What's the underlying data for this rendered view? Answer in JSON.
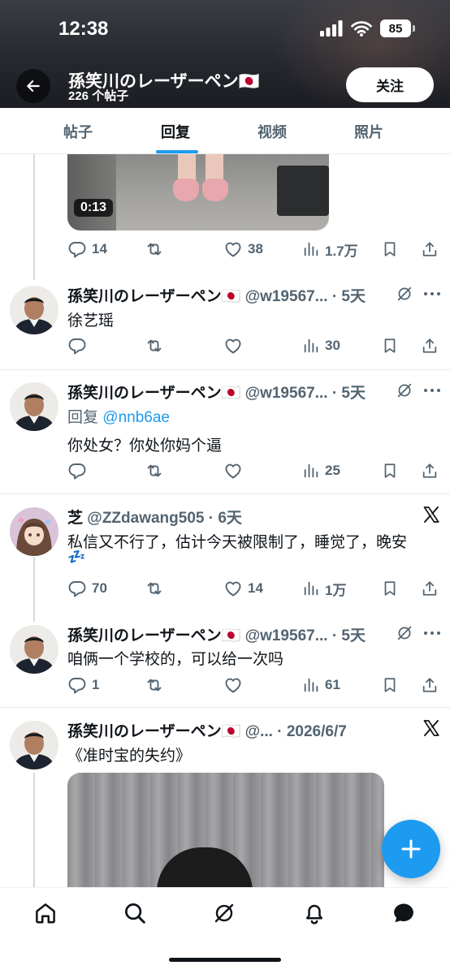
{
  "status_bar": {
    "time": "12:38",
    "battery": "85"
  },
  "header": {
    "profile_name": "孫笑川のレーザーペン🇯🇵",
    "post_count": "226 个帖子",
    "follow_label": "关注"
  },
  "tabs": [
    "帖子",
    "回复",
    "视频",
    "照片"
  ],
  "top_video": {
    "duration": "0:13",
    "stats": {
      "replies": "14",
      "reposts": "",
      "likes": "38",
      "views": "1.7万"
    }
  },
  "posts": [
    {
      "name": "孫笑川のレーザーペン🇯🇵",
      "handle": "@w19567...",
      "time": "· 5天",
      "text": "徐艺瑶",
      "stats": {
        "replies": "",
        "likes": "",
        "views": "30"
      }
    },
    {
      "name": "孫笑川のレーザーペン🇯🇵",
      "handle": "@w19567...",
      "time": "· 5天",
      "reply_prefix": "回复",
      "reply_to": "@nnb6ae",
      "text": "你处女？你处你妈个逼",
      "stats": {
        "replies": "",
        "likes": "",
        "views": "25"
      }
    },
    {
      "name": "芝",
      "handle": "@ZZdawang505",
      "time": "· 6天",
      "text": "私信又不行了，估计今天被限制了，睡觉了，晚安",
      "emoji": "💤",
      "stats": {
        "replies": "70",
        "likes": "14",
        "views": "1万"
      }
    },
    {
      "name": "孫笑川のレーザーペン🇯🇵",
      "handle": "@w19567...",
      "time": "· 5天",
      "text": "咱俩一个学校的，可以给一次吗",
      "stats": {
        "replies": "1",
        "likes": "",
        "views": "61"
      }
    },
    {
      "name": "孫笑川のレーザーペン🇯🇵",
      "handle": "@...",
      "time": "· 2026/6/7",
      "text": "《准时宝的失约》"
    }
  ],
  "colors": {
    "accent": "#1d9bf0",
    "muted": "#536471",
    "text": "#0f1419"
  },
  "icons": [
    "back-arrow-icon",
    "reply-icon",
    "repost-icon",
    "like-icon",
    "views-icon",
    "bookmark-icon",
    "share-icon",
    "grok-icon",
    "more-icon",
    "x-logo-icon",
    "home-icon",
    "search-icon",
    "grok-nav-icon",
    "bell-icon",
    "messages-icon",
    "plus-icon"
  ]
}
